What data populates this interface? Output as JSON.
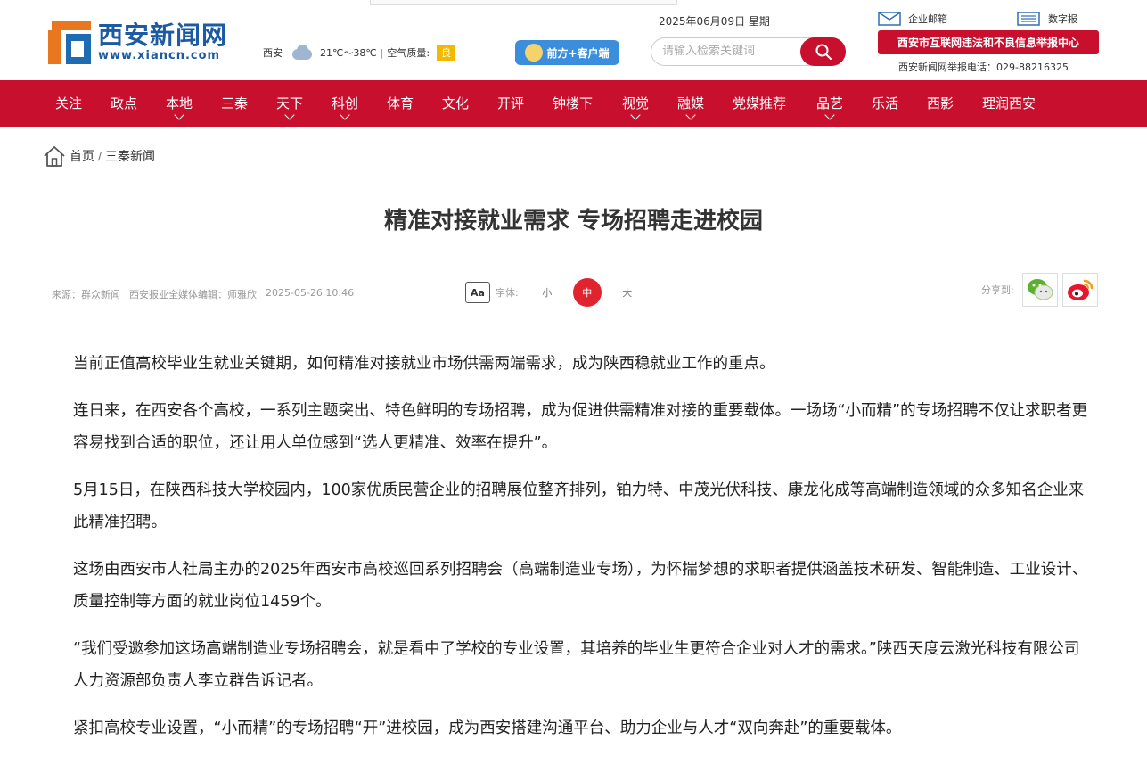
{
  "header": {
    "logo_cn": "西安新闻网",
    "logo_en": "www.xiancn.com",
    "date": "2025年06月09日 星期一",
    "weather": {
      "city": "西安",
      "temp": "21℃～38℃",
      "aq_label": "空气质量:",
      "aq_value": "良"
    },
    "app_button": "前方+客户端",
    "search_placeholder": "请输入检索关键词",
    "mail_label": "企业邮箱",
    "paper_label": "数字报",
    "report_button": "西安市互联网违法和不良信息举报中心",
    "report_phone": "西安新闻网举报电话：029-88216325"
  },
  "nav": {
    "items": [
      {
        "label": "关注"
      },
      {
        "label": "政点"
      },
      {
        "label": "本地"
      },
      {
        "label": "三秦"
      },
      {
        "label": "天下"
      },
      {
        "label": "科创"
      },
      {
        "label": "体育"
      },
      {
        "label": "文化"
      },
      {
        "label": "开评"
      },
      {
        "label": "钟楼下"
      },
      {
        "label": "视觉"
      },
      {
        "label": "融媒"
      },
      {
        "label": "党媒推荐"
      },
      {
        "label": "品艺"
      },
      {
        "label": "乐活"
      },
      {
        "label": "西影"
      },
      {
        "label": "理润西安"
      }
    ]
  },
  "breadcrumb": {
    "home": "首页",
    "separator": "/",
    "section": "三秦新闻"
  },
  "article": {
    "title": "精准对接就业需求 专场招聘走进校园",
    "source": "来源：群众新闻",
    "editor": "西安报业全媒体编辑：师雅欣",
    "datetime": "2025-05-26 10:46",
    "font_label": "字体:",
    "font_icon_text": "Aa",
    "font_small": "小",
    "font_medium": "中",
    "font_large": "大",
    "share_label": "分享到:",
    "paragraphs": [
      "当前正值高校毕业生就业关键期，如何精准对接就业市场供需两端需求，成为陕西稳就业工作的重点。",
      "连日来，在西安各个高校，一系列主题突出、特色鲜明的专场招聘，成为促进供需精准对接的重要载体。一场场“小而精”的专场招聘不仅让求职者更容易找到合适的职位，还让用人单位感到“选人更精准、效率在提升”。",
      "5月15日，在陕西科技大学校园内，100家优质民营企业的招聘展位整齐排列，铂力特、中茂光伏科技、康龙化成等高端制造领域的众多知名企业来此精准招聘。",
      "这场由西安市人社局主办的2025年西安市高校巡回系列招聘会（高端制造业专场），为怀揣梦想的求职者提供涵盖技术研发、智能制造、工业设计、质量控制等方面的就业岗位1459个。",
      "“我们受邀参加这场高端制造业专场招聘会，就是看中了学校的专业设置，其培养的毕业生更符合企业对人才的需求。”陕西天度云激光科技有限公司人力资源部负责人李立群告诉记者。",
      "紧扣高校专业设置，“小而精”的专场招聘“开”进校园，成为西安搭建沟通平台、助力企业与人才“双向奔赴”的重要载体。"
    ]
  },
  "colors": {
    "brand_red": "#c8102e",
    "brand_blue": "#1c5aa3",
    "accent_orange": "#e8771f"
  }
}
